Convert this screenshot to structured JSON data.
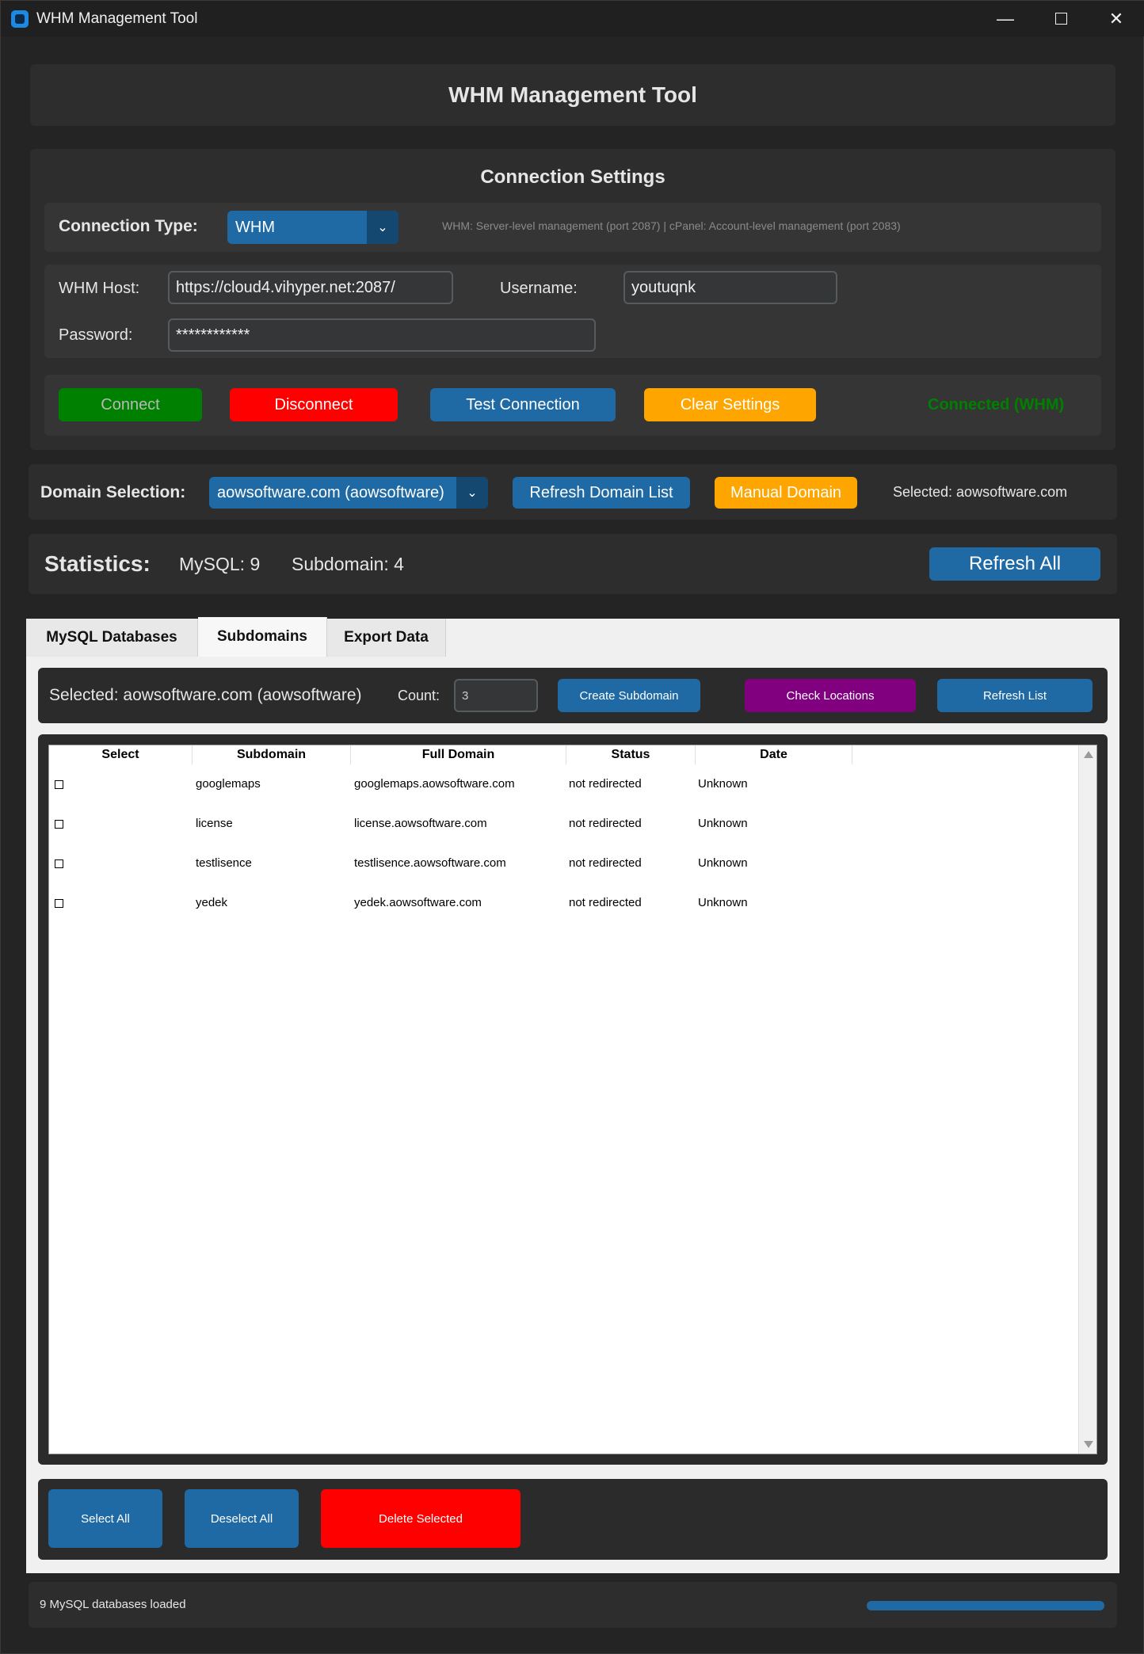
{
  "window": {
    "title": "WHM Management Tool"
  },
  "header": {
    "title": "WHM Management Tool"
  },
  "connection": {
    "section_title": "Connection Settings",
    "type_label": "Connection Type:",
    "type_value": "WHM",
    "type_hint": "WHM: Server-level management (port 2087) | cPanel: Account-level management (port 2083)",
    "host_label": "WHM Host:",
    "host_value": "https://cloud4.vihyper.net:2087/",
    "username_label": "Username:",
    "username_value": "youtuqnk",
    "password_label": "Password:",
    "password_value": "************",
    "buttons": {
      "connect": "Connect",
      "disconnect": "Disconnect",
      "test": "Test Connection",
      "clear": "Clear Settings"
    },
    "status": "Connected (WHM)"
  },
  "domain": {
    "label": "Domain Selection:",
    "value": "aowsoftware.com (aowsoftware)",
    "refresh_btn": "Refresh Domain List",
    "manual_btn": "Manual Domain",
    "selected": "Selected: aowsoftware.com"
  },
  "stats": {
    "label": "Statistics:",
    "mysql": "MySQL: 9",
    "subdomain": "Subdomain: 4",
    "refresh_btn": "Refresh All"
  },
  "tabs": [
    "MySQL Databases",
    "Subdomains",
    "Export Data"
  ],
  "subdomains": {
    "selected": "Selected: aowsoftware.com (aowsoftware)",
    "count_label": "Count:",
    "count_value": "3",
    "create_btn": "Create Subdomain",
    "check_btn": "Check Locations",
    "refresh_btn": "Refresh List",
    "columns": [
      "Select",
      "Subdomain",
      "Full Domain",
      "Status",
      "Date"
    ],
    "rows": [
      {
        "subdomain": "googlemaps",
        "full": "googlemaps.aowsoftware.com",
        "status": "not redirected",
        "date": "Unknown"
      },
      {
        "subdomain": "license",
        "full": "license.aowsoftware.com",
        "status": "not redirected",
        "date": "Unknown"
      },
      {
        "subdomain": "testlisence",
        "full": "testlisence.aowsoftware.com",
        "status": "not redirected",
        "date": "Unknown"
      },
      {
        "subdomain": "yedek",
        "full": "yedek.aowsoftware.com",
        "status": "not redirected",
        "date": "Unknown"
      }
    ],
    "select_all": "Select All",
    "deselect_all": "Deselect All",
    "delete_selected": "Delete Selected"
  },
  "statusbar": {
    "text": "9 MySQL databases loaded",
    "progress": 1.0
  },
  "colors": {
    "accent": "#1f6aa5",
    "connect": "#008000",
    "danger": "#ff0000",
    "warning": "#ffa500",
    "purple": "#800080",
    "status_ok": "#008000"
  },
  "icons": [
    "app-icon",
    "minimize-icon",
    "maximize-icon",
    "close-icon",
    "chevron-down-icon",
    "checkbox-icon",
    "scroll-up-icon",
    "scroll-down-icon"
  ]
}
